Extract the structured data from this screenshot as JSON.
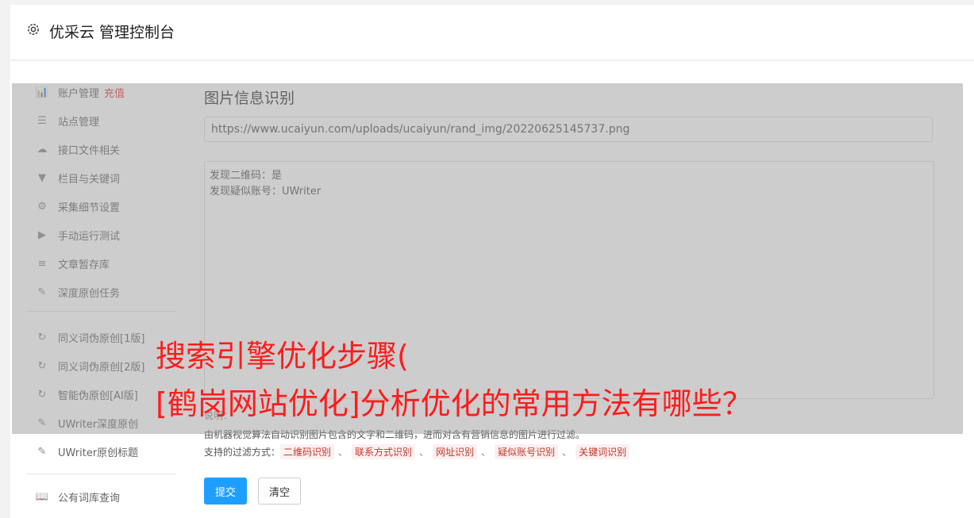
{
  "header": {
    "title": "优采云 管理控制台"
  },
  "sidebar": {
    "items": [
      {
        "label": "账户管理",
        "extra": "充值",
        "icon": "bar-chart-icon",
        "glyph": "📊"
      },
      {
        "label": "站点管理",
        "icon": "server-icon",
        "glyph": "☰"
      },
      {
        "label": "接口文件相关",
        "icon": "cloud-upload-icon",
        "glyph": "☁"
      },
      {
        "label": "栏目与关键词",
        "icon": "filter-icon",
        "glyph": "▼"
      },
      {
        "label": "采集细节设置",
        "icon": "cogs-icon",
        "glyph": "⚙"
      },
      {
        "label": "手动运行测试",
        "icon": "play-circle-icon",
        "glyph": "▶"
      },
      {
        "label": "文章暂存库",
        "icon": "database-icon",
        "glyph": "≡"
      },
      {
        "label": "深度原创任务",
        "icon": "edit-icon",
        "glyph": "✎"
      },
      {
        "label": "同义词伪原创[1版]",
        "icon": "refresh-icon",
        "glyph": "↻"
      },
      {
        "label": "同义词伪原创[2版]",
        "icon": "refresh-icon",
        "glyph": "↻"
      },
      {
        "label": "智能伪原创[AI版]",
        "icon": "refresh-icon",
        "glyph": "↻"
      },
      {
        "label": "UWriter深度原创",
        "icon": "edit-icon",
        "glyph": "✎"
      },
      {
        "label": "UWriter原创标题",
        "icon": "edit-icon",
        "glyph": "✎"
      },
      {
        "label": "公有词库查询",
        "icon": "book-icon",
        "glyph": "📖"
      }
    ]
  },
  "main": {
    "section_title": "图片信息识别",
    "url_value": "https://www.ucaiyun.com/uploads/ucaiyun/rand_img/20220625145737.png",
    "result_lines": [
      "发现二维码：是",
      "发现疑似账号：UWriter"
    ],
    "note_label": "说明：",
    "note_text": "由机器视觉算法自动识别图片包含的文字和二维码，进而对含有营销信息的图片进行过滤。",
    "filter_label": "支持的过滤方式：",
    "filter_tags": [
      "二维码识别",
      "联系方式识别",
      "网址识别",
      "疑似账号识别",
      "关键词识别"
    ],
    "filter_sep": "、",
    "submit_label": "提交",
    "clear_label": "清空"
  },
  "overlay": {
    "line1": "搜索引擎优化步骤(",
    "line2": "[鹤岗网站优化]分析优化的常用方法有哪些？"
  },
  "colors": {
    "accent": "#1e9fff",
    "headline": "#ff1c1c",
    "tag_text": "#c0392b",
    "recharge": "#e03b3b"
  }
}
